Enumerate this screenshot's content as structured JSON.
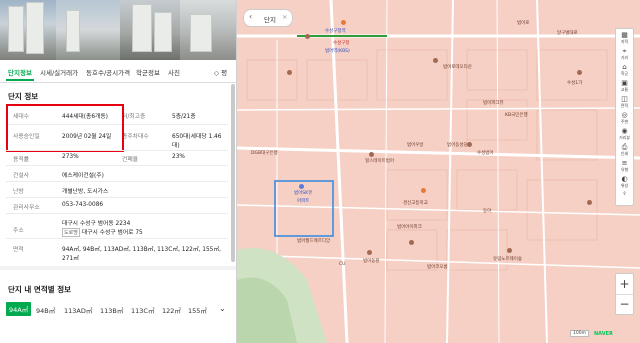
{
  "tabs": [
    {
      "label": "단지정보",
      "active": true
    },
    {
      "label": "시세/실거래가",
      "active": false
    },
    {
      "label": "동호수/공시가격",
      "active": false
    },
    {
      "label": "학군정보",
      "active": false
    },
    {
      "label": "사진",
      "active": false
    },
    {
      "label": "◇ 평",
      "active": false
    }
  ],
  "info": {
    "title": "단지 정보",
    "households_label": "세대수",
    "households_value": "444세대(총6개동)",
    "floors_label": "저/최고층",
    "floors_value": "5층/21층",
    "approval_label": "사용승인일",
    "approval_value": "2009년 02월 24일",
    "parking_label": "총주차대수",
    "parking_value": "650대(세대당 1.46",
    "parking_value2": "대)",
    "far_label": "용적률",
    "far_value": "273%",
    "bcr_label": "건폐율",
    "bcr_value": "23%",
    "builder_label": "건설사",
    "builder_value": "에스케이건설(주)",
    "heating_label": "난방",
    "heating_value": "개별난방, 도시가스",
    "office_label": "관리사무소",
    "office_value": "053-743-0086",
    "address_label": "주소",
    "address_value": "대구시 수성구 범어동 2234",
    "road_tag": "도로명",
    "road_value": "대구시 수성구 범어로 75",
    "area_label": "면적",
    "area_value": "94A㎡, 94B㎡, 113AD㎡, 113B㎡, 113C㎡, 122㎡, 155㎡, 271㎡"
  },
  "area_section": {
    "title": "단지 내 면적별 정보",
    "tabs": [
      "94A㎡",
      "94B㎡",
      "113AD㎡",
      "113B㎡",
      "113C㎡",
      "122㎡",
      "155㎡"
    ]
  },
  "map": {
    "search_label": "단지",
    "toolbar": [
      "지적",
      "거리",
      "학군",
      "교통",
      "면적",
      "주변",
      "거리뷰",
      "인쇄",
      "유형",
      "위성",
      "공유"
    ],
    "labels": [
      {
        "text": "수성구청역",
        "cls": "blue"
      },
      {
        "text": "범어역(KBS)",
        "cls": "blue"
      },
      {
        "text": "범어로데오타운",
        "cls": ""
      },
      {
        "text": "범어SK뷰",
        "cls": "blue"
      },
      {
        "text": "아파트",
        "cls": "blue"
      },
      {
        "text": "힐스테이트범어",
        "cls": ""
      },
      {
        "text": "범어우방",
        "cls": ""
      },
      {
        "text": "범어동성당",
        "cls": ""
      },
      {
        "text": "수성범어",
        "cls": ""
      },
      {
        "text": "경신고등학교",
        "cls": ""
      },
      {
        "text": "범어아이파크",
        "cls": ""
      },
      {
        "text": "동아",
        "cls": ""
      },
      {
        "text": "유림노르웨이숲",
        "cls": ""
      },
      {
        "text": "범어동원",
        "cls": ""
      },
      {
        "text": "범어코오롱",
        "cls": ""
      },
      {
        "text": "범어월드메르디앙",
        "cls": ""
      },
      {
        "text": "CU",
        "cls": ""
      },
      {
        "text": "KB국민은행",
        "cls": ""
      },
      {
        "text": "수성1가",
        "cls": ""
      },
      {
        "text": "DGB대구은행",
        "cls": ""
      },
      {
        "text": "범어파크뷰",
        "cls": ""
      },
      {
        "text": "수성구청",
        "cls": "red"
      },
      {
        "text": "범어로",
        "cls": ""
      },
      {
        "text": "달구벌대로",
        "cls": ""
      }
    ],
    "footer": "NAVER",
    "scale": "100m"
  }
}
